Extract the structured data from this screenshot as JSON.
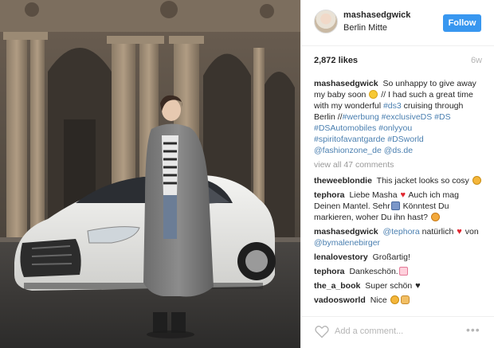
{
  "header": {
    "username": "mashasedgwick",
    "location": "Berlin Mitte",
    "follow_label": "Follow"
  },
  "post": {
    "likes": "2,872 likes",
    "age": "6w"
  },
  "caption": {
    "user": "mashasedgwick",
    "text_1": "So unhappy to give away my baby soon",
    "text_2": "// I had such a great time with my wonderful",
    "hashtag_ds3": "#ds3",
    "text_3": "cruising through Berlin //",
    "hashtags": "#werbung #exclusiveDS #DS #DSAutomobiles #onlyyou #spiritofavantgarde #DSworld",
    "mentions": "@fashionzone_de @ds.de"
  },
  "view_all": "view all 47 comments",
  "comments": [
    {
      "user": "theweeblondie",
      "text": "This jacket looks so cosy"
    },
    {
      "user": "tephora",
      "text_1": "Liebe Masha",
      "text_2": "Auch ich mag Deinen Mantel. Sehr",
      "text_3": "Könntest Du markieren, woher Du ihn hast?"
    },
    {
      "user": "mashasedgwick",
      "mention": "@tephora",
      "text_1": "natürlich",
      "text_2": "von",
      "mention_2": "@bymalenebirger"
    },
    {
      "user": "lenalovestory",
      "text": "Großartig!"
    },
    {
      "user": "tephora",
      "text": "Dankeschön."
    },
    {
      "user": "the_a_book",
      "text": "Super schön"
    },
    {
      "user": "vadoosworld",
      "text": "Nice"
    }
  ],
  "footer": {
    "add_comment_placeholder": "Add a comment...",
    "more_label": "•••"
  },
  "icons": {
    "like": "heart-outline-icon",
    "more": "more-options-icon"
  },
  "colors": {
    "follow_button": "#3897f0",
    "link": "#4a7fb0",
    "muted": "#999999"
  }
}
